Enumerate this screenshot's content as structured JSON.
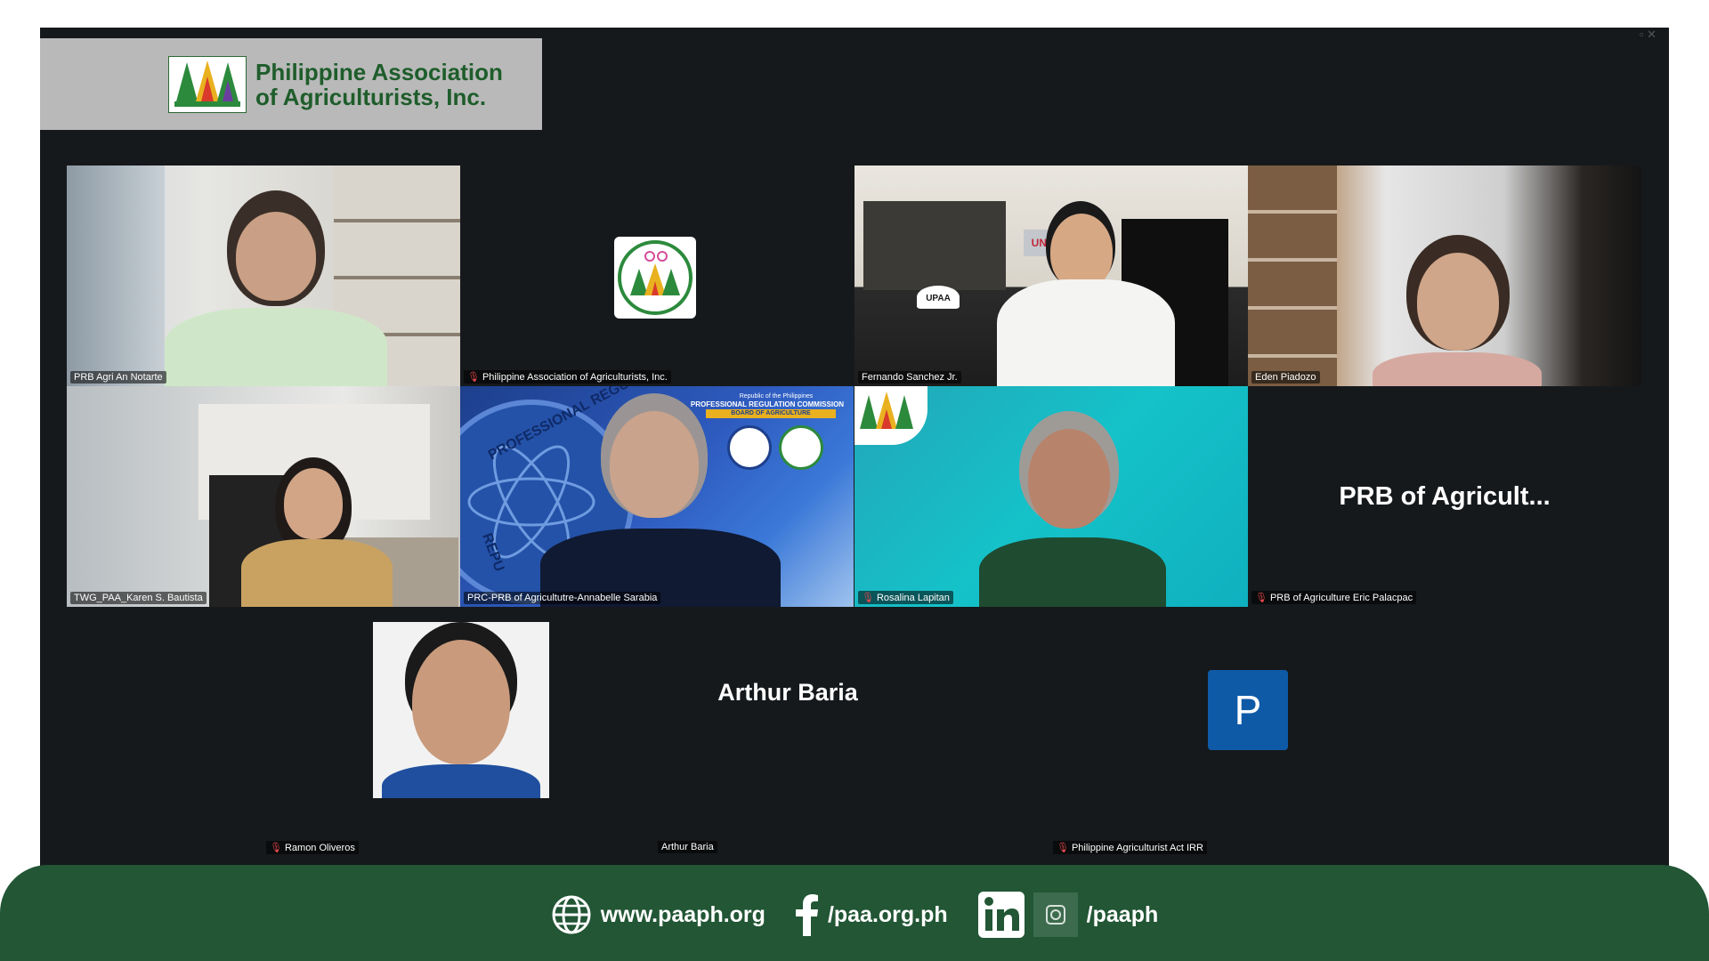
{
  "banner": {
    "org_name_line1": "Philippine Association",
    "org_name_line2": "of Agriculturists, Inc."
  },
  "tiles": [
    {
      "name": "PRB Agri An Notarte",
      "muted": false,
      "active": false
    },
    {
      "name": "Philippine Association of Agriculturists, Inc.",
      "muted": true,
      "active": false
    },
    {
      "name": "Fernando Sanchez Jr.",
      "muted": false,
      "active": false
    },
    {
      "name": "Eden Piadozo",
      "muted": false,
      "active": false
    },
    {
      "name": "TWG_PAA_Karen S. Bautista",
      "muted": false,
      "active": true
    },
    {
      "name": "PRC-PRB of Agricultutre-Annabelle Sarabia",
      "muted": false,
      "active": false
    },
    {
      "name": "Rosalina Lapitan",
      "muted": true,
      "active": false
    },
    {
      "name": "PRB of Agriculture Eric Palacpac",
      "muted": true,
      "active": false,
      "display_text": "PRB of Agricult..."
    }
  ],
  "prc_backdrop": {
    "line1": "Republic of the Philippines",
    "line2": "PROFESSIONAL REGULATION COMMISSION",
    "line3": "BOARD OF AGRICULTURE",
    "seal_text": "PROFESSIONAL REGULATIO",
    "seal_text2": "REPU"
  },
  "shelf_cap_text": "UPAA",
  "trophy_text": "UNO",
  "bottom_row": {
    "ramon": {
      "name": "Ramon Oliveros",
      "muted": true
    },
    "arthur": {
      "name": "Arthur Baria",
      "display_text": "Arthur Baria",
      "muted": false
    },
    "p_participant": {
      "initial": "P",
      "name": "Philippine Agriculturist Act IRR",
      "muted": true
    }
  },
  "footer": {
    "website": "www.paaph.org",
    "facebook": "/paa.org.ph",
    "social": "/paaph"
  },
  "colors": {
    "footer_green": "#225635",
    "banner_text_green": "#1e5d2b",
    "active_speaker_border": "#33d17a",
    "avatar_blue": "#0e5aa7",
    "meeting_background": "#16191c"
  }
}
